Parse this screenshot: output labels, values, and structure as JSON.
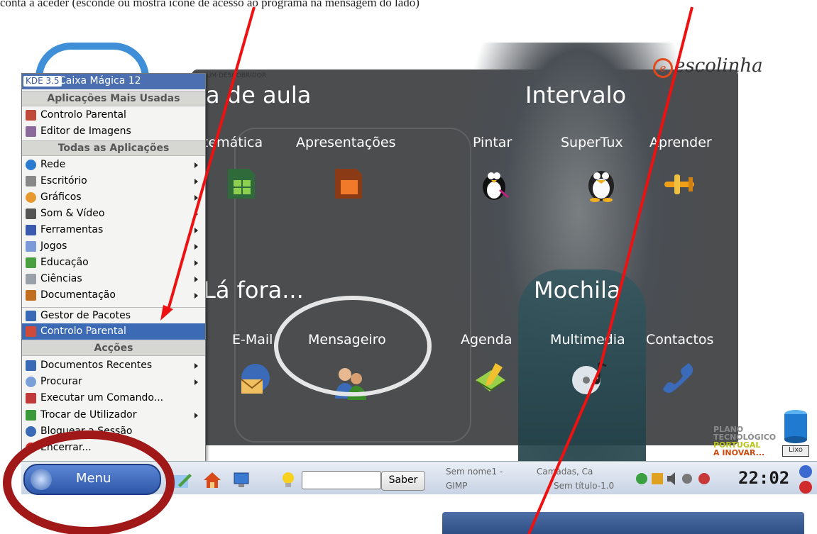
{
  "caption": "conta a aceder (esconde ou mostra ícone de acesso ao programa na mensagem do lado)",
  "desktop": {
    "logo_small": "ICA, UM DESCOBRIDOR",
    "escolinha": "escolinha",
    "sections": {
      "sala": "a de aula",
      "intervalo": "Intervalo",
      "la_fora": "Lá fora...",
      "mochila": "Mochila"
    },
    "apps": {
      "matematica": "temática",
      "apresentacoes": "Apresentações",
      "pintar": "Pintar",
      "supertux": "SuperTux",
      "aprender": "Aprender",
      "email": "E-Mail",
      "mensageiro": "Mensageiro",
      "agenda": "Agenda",
      "multimedia": "Multimedia",
      "contactos": "Contactos"
    },
    "plano": [
      "PLANO",
      "TECNOLÓGICO",
      "PORTUGAL",
      "A INOVAR..."
    ],
    "trash_label": "Lixo"
  },
  "menu": {
    "kde_version": "KDE 3.5",
    "brand": "Caixa Mágica 12",
    "section_most_used": "Aplicações Mais Usadas",
    "most_used": [
      "Controlo Parental",
      "Editor de Imagens"
    ],
    "section_all": "Todas as Aplicações",
    "all_apps": [
      "Rede",
      "Escritório",
      "Gráficos",
      "Som & Vídeo",
      "Ferramentas",
      "Jogos",
      "Educação",
      "Ciências",
      "Documentação"
    ],
    "extra": [
      "Gestor de Pacotes",
      "Controlo Parental"
    ],
    "section_actions": "Acções",
    "actions": [
      "Documentos Recentes",
      "Procurar",
      "Executar um Comando...",
      "Trocar de Utilizador",
      "Bloquear a Sessão",
      "Encerrar..."
    ],
    "highlighted_item": "Controlo Parental"
  },
  "taskbar": {
    "menu_label": "Menu",
    "search_value": "",
    "saber_label": "Saber",
    "tasks": [
      "Sem nome1 -",
      "Camadas, Ca",
      "GIMP",
      "Sem título-1.0"
    ],
    "clock": "22:02"
  },
  "colors": {
    "arrow": "#ee1111",
    "menu_highlight": "#3c6ab5",
    "ellipse_dark": "#a01818",
    "ellipse_light": "#e6e6e6"
  }
}
